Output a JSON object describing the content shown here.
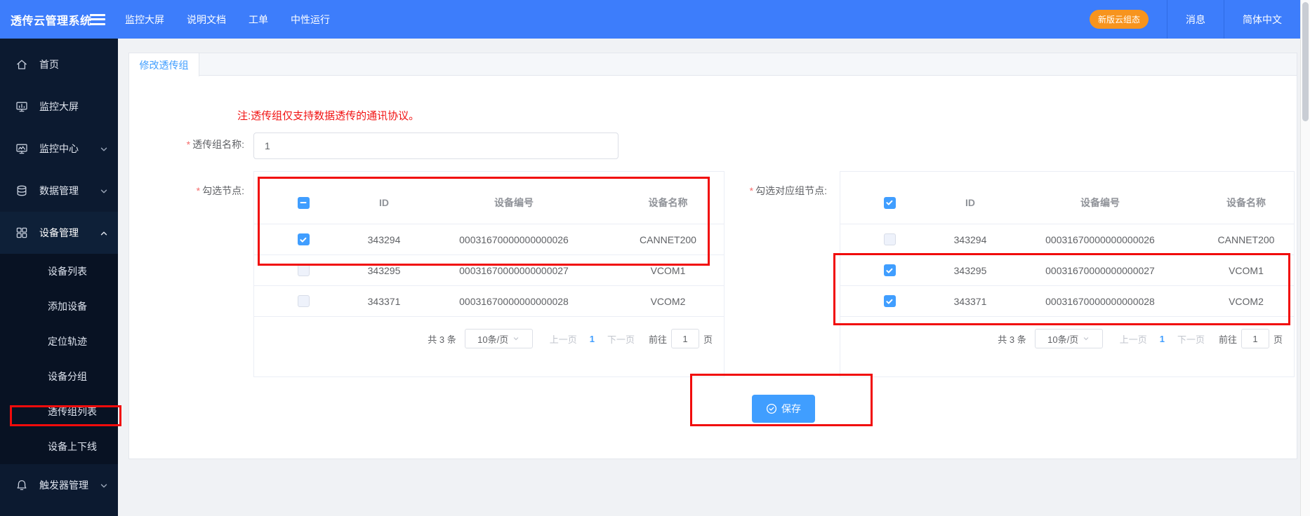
{
  "navbar": {
    "logo": "透传云管理系统",
    "menu": [
      "监控大屏",
      "说明文档",
      "工单",
      "中性运行"
    ],
    "new_version_button": "新版云组态",
    "messages": "消息",
    "language": "简体中文"
  },
  "sidebar": {
    "items": [
      {
        "label": "首页",
        "icon": "home-icon"
      },
      {
        "label": "监控大屏",
        "icon": "big-screen-icon"
      },
      {
        "label": "监控中心",
        "icon": "monitor-center-icon",
        "expandable": true
      },
      {
        "label": "数据管理",
        "icon": "database-icon",
        "expandable": true
      },
      {
        "label": "设备管理",
        "icon": "grid-icon",
        "expandable": true,
        "expanded": true
      },
      {
        "label": "触发器管理",
        "icon": "bell-icon",
        "expandable": true
      }
    ],
    "device_submenu": [
      "设备列表",
      "添加设备",
      "定位轨迹",
      "设备分组",
      "透传组列表",
      "设备上下线"
    ],
    "highlighted_item": "透传组列表"
  },
  "main": {
    "tab": "修改透传组",
    "note": "注:透传组仅支持数据透传的通讯协议。",
    "required_mark": "*",
    "form": {
      "name_label": "透传组名称:",
      "name_value": "1",
      "nodes_label": "勾选节点:",
      "group_nodes_label": "勾选对应组节点:"
    },
    "columns": {
      "id": "ID",
      "code": "设备编号",
      "name": "设备名称"
    },
    "rows": [
      {
        "id": "343294",
        "code": "00031670000000000026",
        "name": "CANNET200"
      },
      {
        "id": "343295",
        "code": "00031670000000000027",
        "name": "VCOM1"
      },
      {
        "id": "343371",
        "code": "00031670000000000028",
        "name": "VCOM2"
      }
    ],
    "left_table": {
      "header_checkbox": "indeterminate",
      "row_checkboxes": [
        "checked",
        "unchecked",
        "unchecked"
      ]
    },
    "right_table": {
      "header_checkbox": "checked",
      "row_checkboxes": [
        "unchecked",
        "checked",
        "checked"
      ]
    },
    "pagination": {
      "total": "共 3 条",
      "page_size": "10条/页",
      "prev": "上一页",
      "page": "1",
      "next": "下一页",
      "goto": "前往",
      "goto_value": "1",
      "unit": "页"
    },
    "save_button": "保存"
  },
  "colors": {
    "navbar_blue": "#3D7DFB",
    "accent_blue": "#409EFF",
    "button_orange": "#F7941E",
    "annotation_red": "#F10B0B",
    "sidebar_dark": "#0C1A30",
    "note_red": "#F11212"
  }
}
